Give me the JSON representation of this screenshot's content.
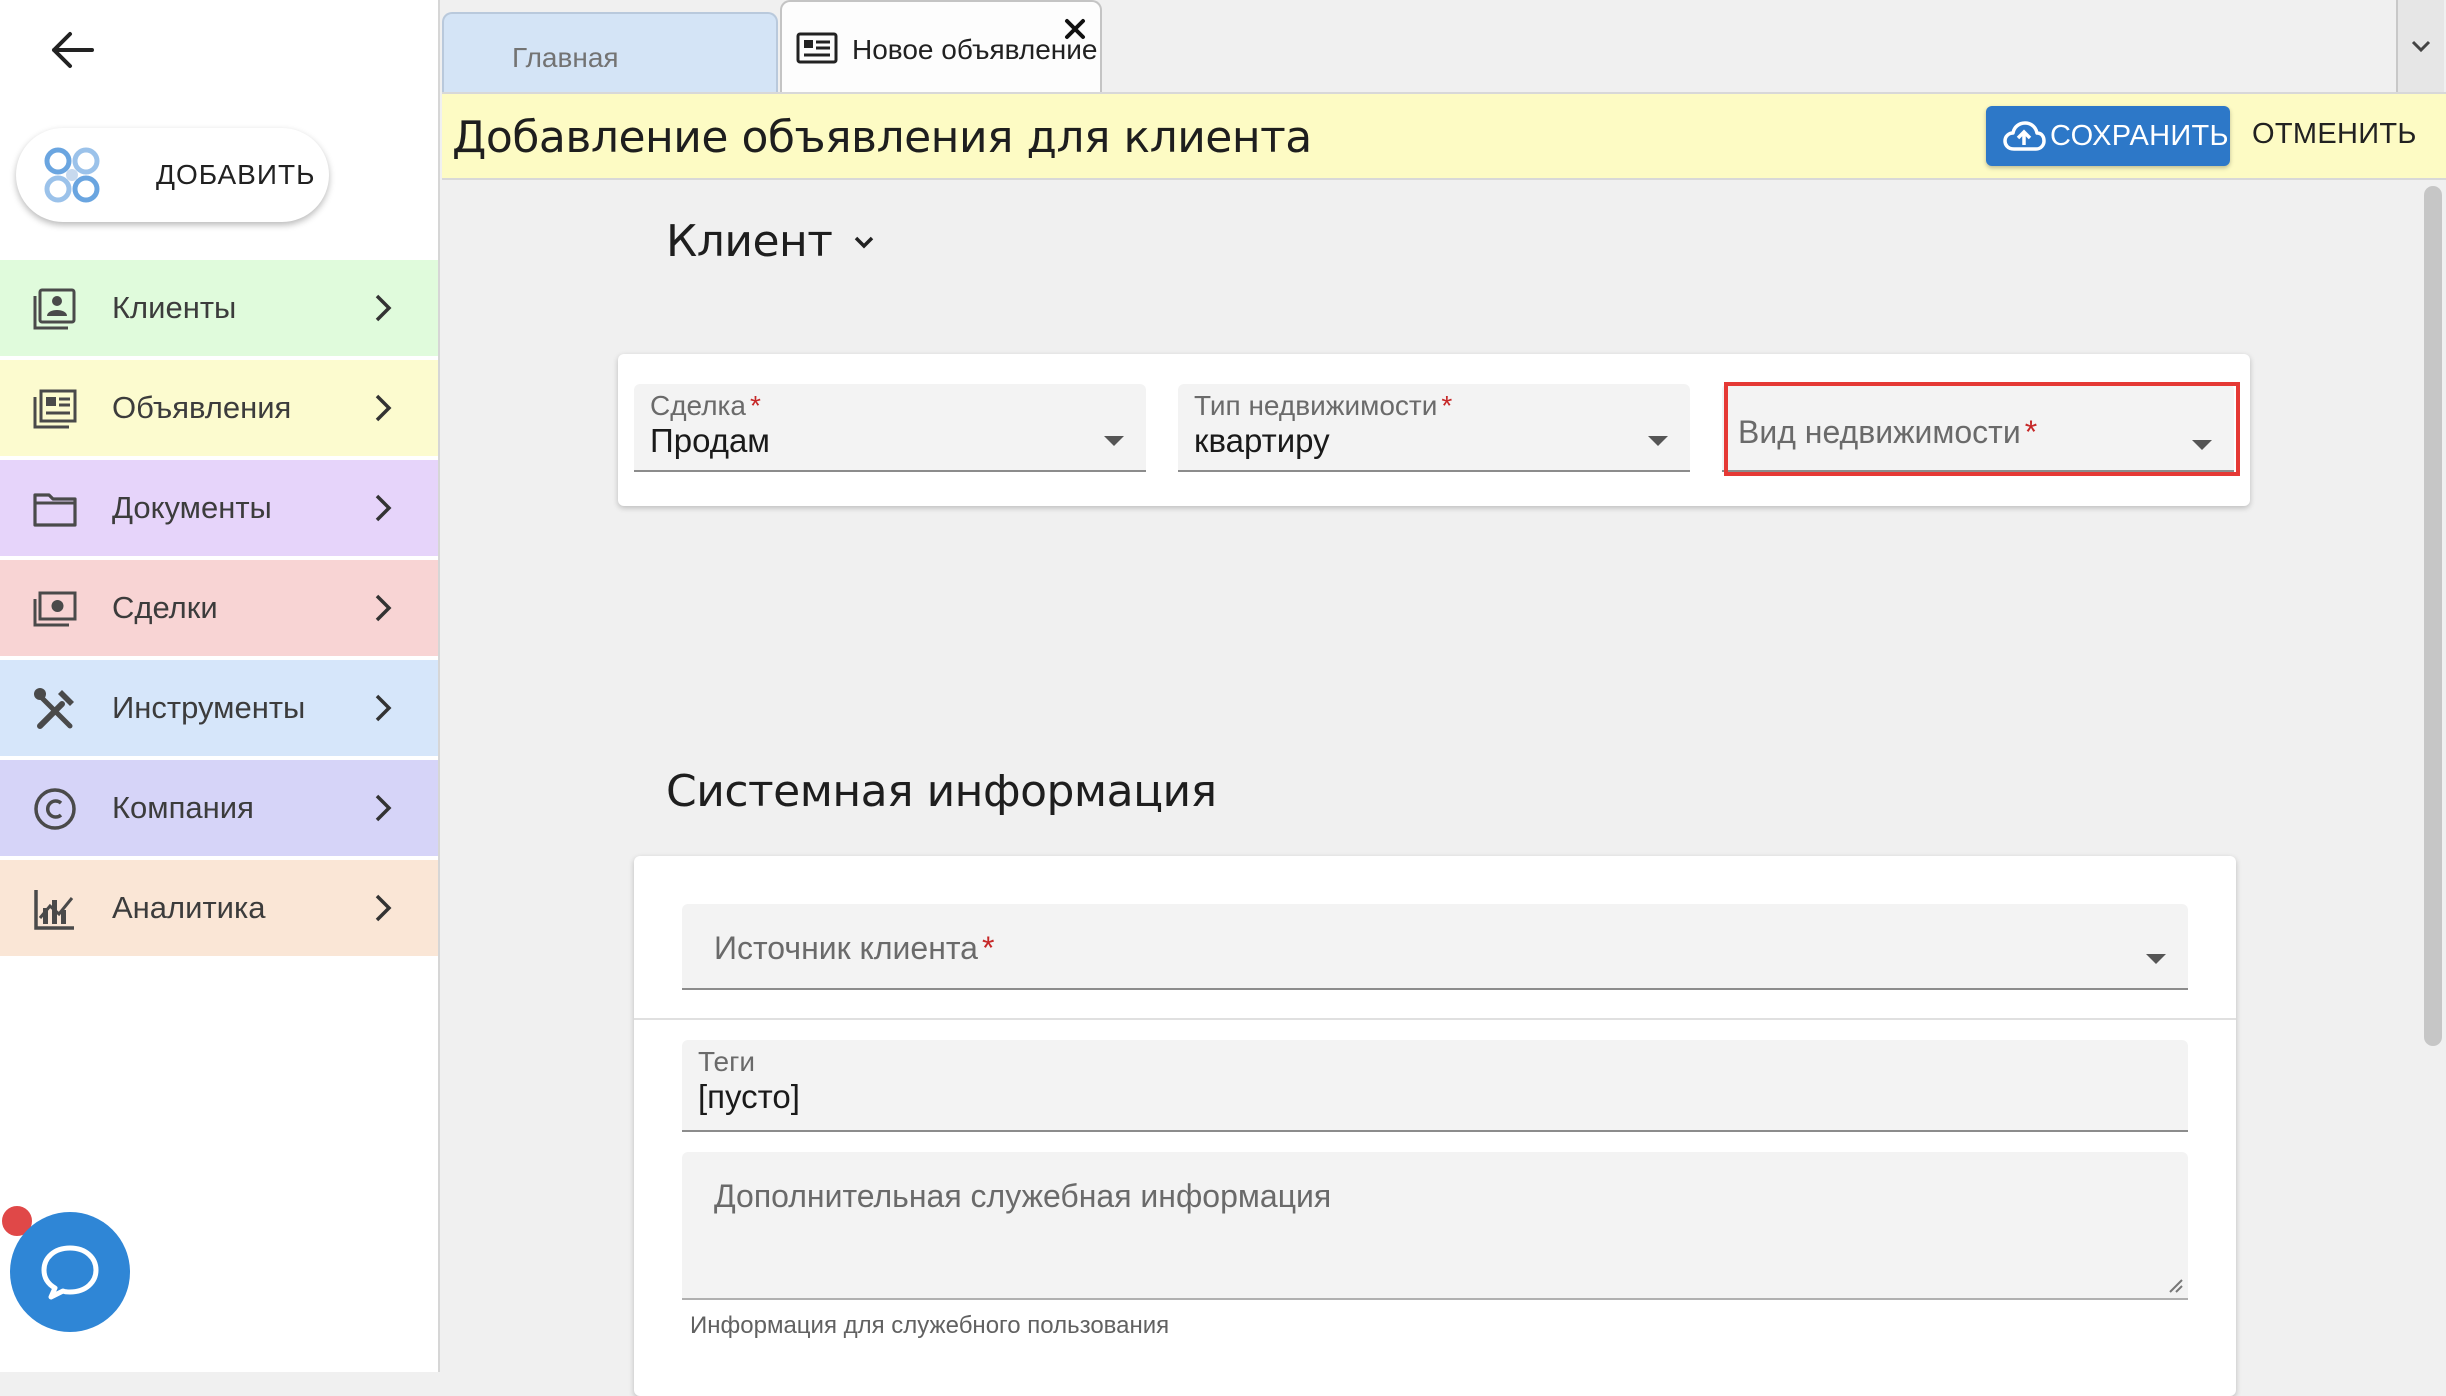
{
  "sidebar": {
    "add_label": "ДОБАВИТЬ",
    "items": [
      {
        "label": "Клиенты",
        "bg": "#e0fbdc",
        "icon": "client-card-icon"
      },
      {
        "label": "Объявления",
        "bg": "#fcfbcf",
        "icon": "listings-icon"
      },
      {
        "label": "Документы",
        "bg": "#e6d4fa",
        "icon": "folder-icon"
      },
      {
        "label": "Сделки",
        "bg": "#f8d4d4",
        "icon": "money-icon"
      },
      {
        "label": "Инструменты",
        "bg": "#d6e6fa",
        "icon": "tools-icon"
      },
      {
        "label": "Компания",
        "bg": "#d6d4f8",
        "icon": "copyright-icon"
      },
      {
        "label": "Аналитика",
        "bg": "#fae6d6",
        "icon": "analytics-icon"
      }
    ]
  },
  "tabs": {
    "home": "Главная",
    "active": "Новое объявление"
  },
  "header": {
    "title": "Добавление объявления для клиента",
    "save": "СОХРАНИТЬ",
    "cancel": "ОТМЕНИТЬ"
  },
  "client_section": {
    "title": "Клиент",
    "deal": {
      "label": "Сделка",
      "value": "Продам"
    },
    "property_type": {
      "label": "Тип недвижимости",
      "value": "квартиру"
    },
    "property_kind": {
      "label": "Вид недвижимости",
      "value": ""
    },
    "required_mark": "*"
  },
  "system_section": {
    "title": "Системная информация",
    "source": {
      "label": "Источник клиента"
    },
    "tags": {
      "label": "Теги",
      "value": "[пусто]"
    },
    "extra": {
      "placeholder": "Дополнительная служебная информация"
    },
    "hint": "Информация для служебного пользования"
  },
  "colors": {
    "accent": "#2d78c8",
    "header_bg": "#fdfbc4",
    "highlight": "#e53935",
    "required": "#c62828"
  }
}
